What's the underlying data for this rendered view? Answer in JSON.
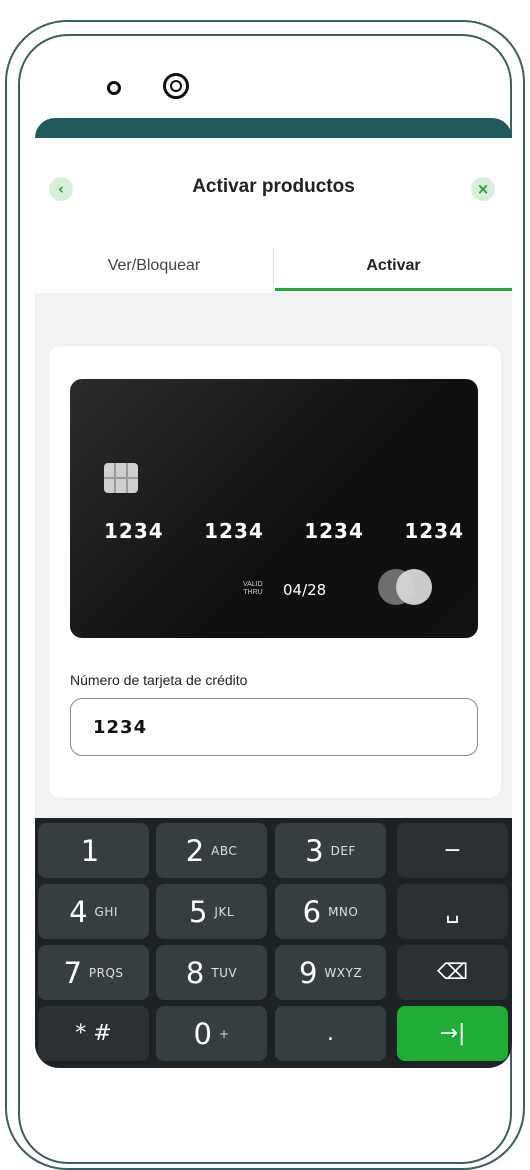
{
  "header": {
    "title": "Activar productos",
    "back_icon": "‹",
    "close_icon": "×"
  },
  "tabs": [
    {
      "label": "Ver/Bloquear",
      "active": false
    },
    {
      "label": "Activar",
      "active": true
    }
  ],
  "card": {
    "number_groups": [
      "1234",
      "1234",
      "1234",
      "1234"
    ],
    "valid_line1": "VALID",
    "valid_line2": "THRU",
    "expiry": "04/28"
  },
  "form": {
    "field_label": "Número de tarjeta de crédito",
    "field_value": "1234"
  },
  "keyboard": {
    "keys": [
      {
        "digit": "1",
        "letters": ""
      },
      {
        "digit": "2",
        "letters": "ABC"
      },
      {
        "digit": "3",
        "letters": "DEF"
      },
      {
        "digit": "−",
        "letters": ""
      },
      {
        "digit": "4",
        "letters": "GHI"
      },
      {
        "digit": "5",
        "letters": "JKL"
      },
      {
        "digit": "6",
        "letters": "MNO"
      },
      {
        "digit": "␣",
        "letters": ""
      },
      {
        "digit": "7",
        "letters": "PRQS"
      },
      {
        "digit": "8",
        "letters": "TUV"
      },
      {
        "digit": "9",
        "letters": "WXYZ"
      },
      {
        "digit": "⌫",
        "letters": ""
      },
      {
        "digit": "* #",
        "letters": ""
      },
      {
        "digit": "0",
        "letters": "+"
      },
      {
        "digit": ".",
        "letters": ""
      },
      {
        "digit": "→|",
        "letters": ""
      }
    ]
  },
  "colors": {
    "accent": "#1fae3a",
    "screen_frame": "#1f5a5c",
    "keyboard_bg": "#1d2324",
    "key_bg": "#373e40"
  }
}
